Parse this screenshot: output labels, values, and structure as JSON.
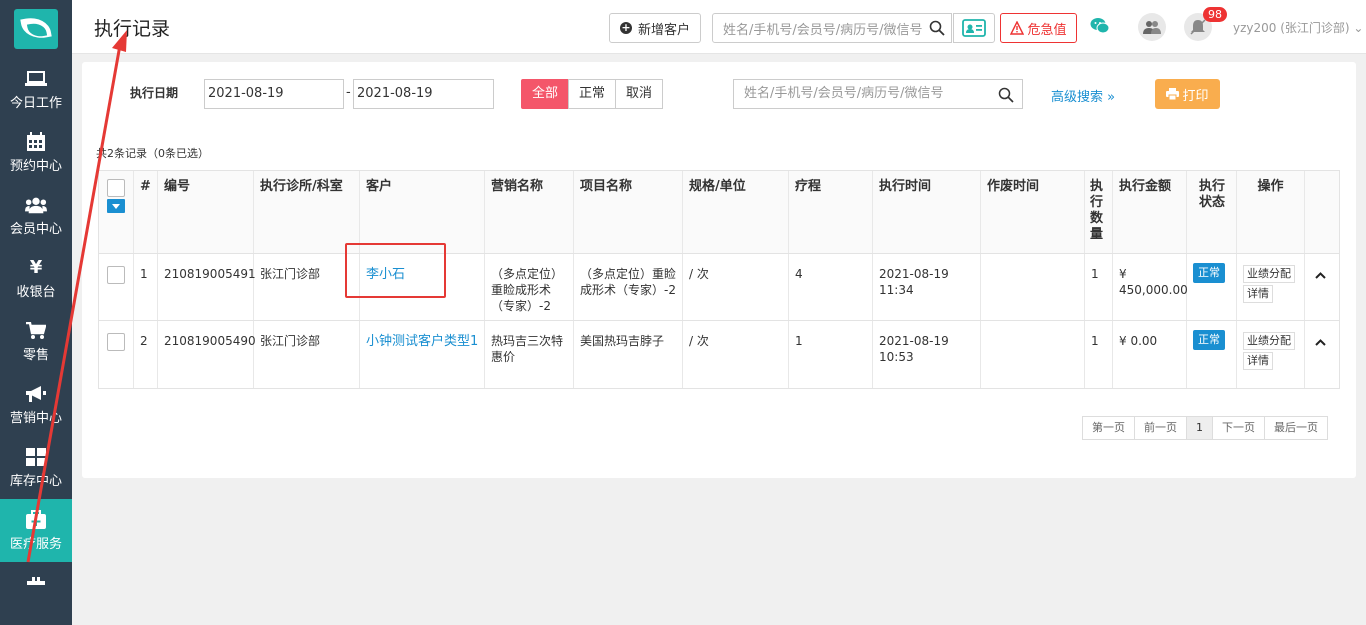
{
  "sidebar": {
    "items": [
      {
        "label": "今日工作",
        "icon": "laptop-icon"
      },
      {
        "label": "预约中心",
        "icon": "calendar-icon"
      },
      {
        "label": "会员中心",
        "icon": "users-icon"
      },
      {
        "label": "收银台",
        "icon": "yen-icon"
      },
      {
        "label": "零售",
        "icon": "cart-icon"
      },
      {
        "label": "营销中心",
        "icon": "megaphone-icon"
      },
      {
        "label": "库存中心",
        "icon": "grid-icon"
      },
      {
        "label": "医疗服务",
        "icon": "medkit-icon"
      }
    ],
    "active": "医疗服务"
  },
  "header": {
    "title": "执行记录",
    "add_customer": "新增客户",
    "search_placeholder": "姓名/手机号/会员号/病历号/微信号",
    "danger_button": "危急值",
    "notification_count": "98",
    "user": "yzy200 (张江门诊部)"
  },
  "filters": {
    "date_label": "执行日期",
    "date_from": "2021-08-19",
    "date_to": "2021-08-19",
    "date_sep": "-",
    "status_tabs": [
      "全部",
      "正常",
      "取消"
    ],
    "search_placeholder": "姓名/手机号/会员号/病历号/微信号",
    "advanced_search": "高级搜索",
    "print": "打印"
  },
  "record_count": "共2条记录（0条已选）",
  "table": {
    "headers": [
      "#",
      "编号",
      "执行诊所/科室",
      "客户",
      "营销名称",
      "项目名称",
      "规格/单位",
      "疗程",
      "执行时间",
      "作废时间",
      "执行数量",
      "执行金额",
      "执行状态",
      "操作"
    ],
    "rows": [
      {
        "index": "1",
        "number": "210819005491",
        "clinic": "张江门诊部",
        "customer": "李小石",
        "marketing": "（多点定位）重睑成形术（专家）-2",
        "project": "（多点定位）重睑成形术（专家）-2",
        "spec": "/ 次",
        "course": "4",
        "exec_date": "2021-08-19",
        "exec_time": "11:34",
        "void_time": "",
        "qty": "1",
        "amount_symbol": "¥",
        "amount": "450,000.00",
        "status": "正常",
        "ops": [
          "业绩分配",
          "详情"
        ]
      },
      {
        "index": "2",
        "number": "210819005490",
        "clinic": "张江门诊部",
        "customer": "小钟测试客户类型1",
        "marketing": "热玛吉三次特惠价",
        "project": "美国热玛吉脖子",
        "spec": "/ 次",
        "course": "1",
        "exec_date": "2021-08-19",
        "exec_time": "10:53",
        "void_time": "",
        "qty": "1",
        "amount_symbol": "¥",
        "amount": "0.00",
        "status": "正常",
        "ops": [
          "业绩分配",
          "详情"
        ]
      }
    ]
  },
  "pagination": {
    "first": "第一页",
    "prev": "前一页",
    "current": "1",
    "next": "下一页",
    "last": "最后一页"
  },
  "colors": {
    "sidebar_bg": "#2f4050",
    "sidebar_active": "#1fb5ac",
    "link": "#1a8fd1",
    "accent_pink": "#f4566a",
    "print_orange": "#f9ad4e",
    "annotation_red": "#e53935"
  }
}
